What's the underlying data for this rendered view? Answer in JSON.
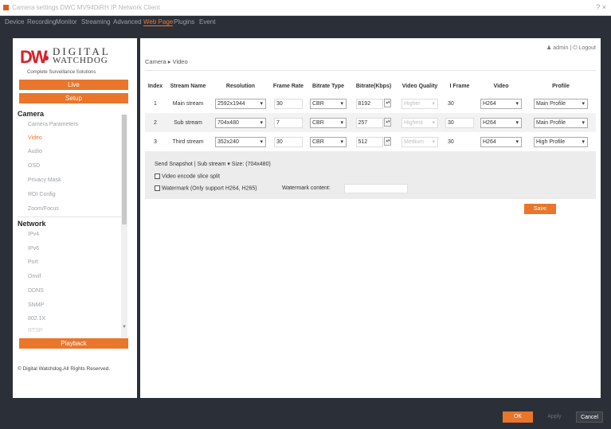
{
  "window": {
    "title": "Camera settings  DWC  MV94DiRH  IP Network Client",
    "controls": "?  ×"
  },
  "menu": [
    {
      "label": "Device"
    },
    {
      "label": "Recording"
    },
    {
      "label": "Monitor"
    },
    {
      "label": "Streaming"
    },
    {
      "label": "Advanced"
    },
    {
      "label": "Web Page"
    },
    {
      "label": "Plugins"
    },
    {
      "label": "Event"
    }
  ],
  "brand": {
    "dw": "DW",
    "line1": "DIGITAL",
    "line2": "WATCHDOG",
    "tagline": "Complete Surveillance Solutions"
  },
  "sidebar": {
    "live": "Live",
    "setup": "Setup",
    "camera_head": "Camera",
    "camera_items": [
      "Camera Parameters",
      "Video",
      "Audio",
      "OSD",
      "Privacy Mask",
      "ROI Config",
      "Zoom/Focus"
    ],
    "network_head": "Network",
    "network_items": [
      "IPv4",
      "IPv6",
      "Port",
      "Onvif",
      "DDNS",
      "SNMP",
      "802.1X",
      "RTSP"
    ],
    "playback": "Playback",
    "copyright": "© Digital Watchdog.All Rights Reserved."
  },
  "header": {
    "user": "admin",
    "logout": "Logout",
    "breadcrumb": "Camera ▸ Video"
  },
  "table": {
    "headers": [
      "Index",
      "Stream Name",
      "Resolution",
      "Frame Rate",
      "Bitrate Type",
      "Bitrate(Kbps)",
      "Video Quality",
      "I Frame",
      "Video",
      "Profile"
    ],
    "rows": [
      {
        "index": "1",
        "name": "Main stream",
        "resolution": "2592x1944",
        "framerate": "30",
        "bitrate_type": "CBR",
        "bitrate": "8192",
        "quality": "Higher",
        "iframe": "30",
        "video": "H264",
        "profile": "Main Profile"
      },
      {
        "index": "2",
        "name": "Sub stream",
        "resolution": "704x480",
        "framerate": "7",
        "bitrate_type": "CBR",
        "bitrate": "257",
        "quality": "Highest",
        "iframe": "30",
        "video": "H264",
        "profile": "Main Profile"
      },
      {
        "index": "3",
        "name": "Third stream",
        "resolution": "352x240",
        "framerate": "30",
        "bitrate_type": "CBR",
        "bitrate": "512",
        "quality": "Medium",
        "iframe": "30",
        "video": "H264",
        "profile": "High Profile"
      }
    ]
  },
  "options": {
    "snapshot": "Send Snapshot | Sub stream ▾  Size: (704x480)",
    "slice_split": "Video encode slice split",
    "watermark": "Watermark (Only support H264, H265)",
    "watermark_content": "Watermark content:"
  },
  "save": "Save",
  "footer": {
    "ok": "OK",
    "apply": "Apply",
    "cancel": "Cancel"
  },
  "colors": {
    "accent": "#e9762b",
    "brand_red": "#d8202a",
    "frame": "#2b3038"
  }
}
